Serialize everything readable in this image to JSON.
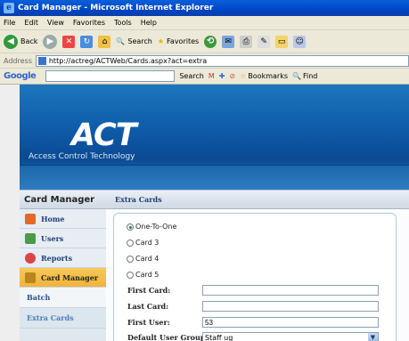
{
  "window": {
    "title": "Card Manager - Microsoft Internet Explorer"
  },
  "menu": [
    "File",
    "Edit",
    "View",
    "Favorites",
    "Tools",
    "Help"
  ],
  "toolbar": {
    "back_label": "Back",
    "search_label": "Search",
    "favorites_label": "Favorites"
  },
  "address": {
    "label": "Address",
    "url": "http://actreg/ACTWeb/Cards.aspx?act=extra"
  },
  "google": {
    "logo": "Google",
    "search_label": "Search",
    "bookmarks_label": "Bookmarks",
    "find_label": "Find"
  },
  "banner": {
    "logo": "ACT",
    "subtitle": "Access Control Technology"
  },
  "sidebar": {
    "title": "Card Manager",
    "items": [
      {
        "label": "Home"
      },
      {
        "label": "Users"
      },
      {
        "label": "Reports"
      },
      {
        "label": "Card Manager"
      }
    ],
    "links": [
      {
        "label": "Batch"
      },
      {
        "label": "Extra Cards"
      }
    ]
  },
  "content": {
    "title": "Extra Cards",
    "radios": [
      {
        "label": "One-To-One",
        "selected": true
      },
      {
        "label": "Card 3",
        "selected": false
      },
      {
        "label": "Card 4",
        "selected": false
      },
      {
        "label": "Card 5",
        "selected": false
      }
    ],
    "fields": {
      "first_card": {
        "label": "First Card:",
        "value": ""
      },
      "last_card": {
        "label": "Last Card:",
        "value": ""
      },
      "first_user": {
        "label": "First User:",
        "value": "53"
      },
      "default_group": {
        "label": "Default User Group:",
        "value": "Staff ug"
      }
    }
  }
}
